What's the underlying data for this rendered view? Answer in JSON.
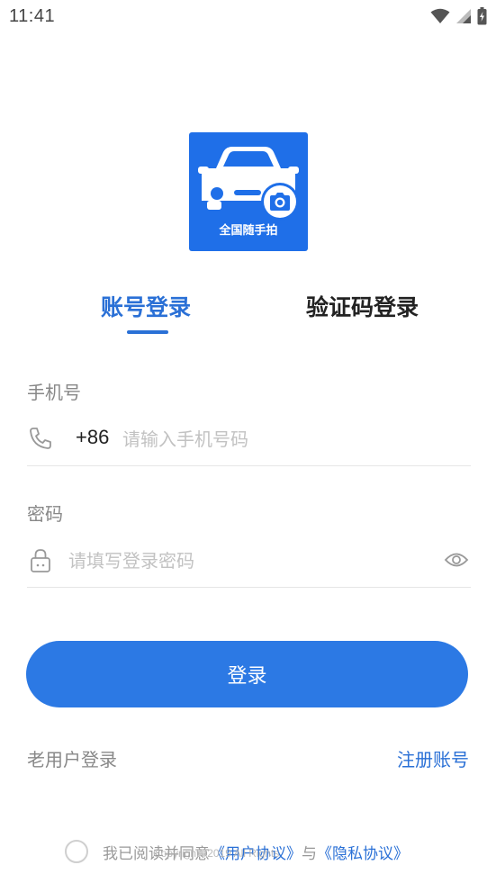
{
  "status_bar": {
    "time": "11:41"
  },
  "logo": {
    "text": "全国随手拍",
    "brand_color": "#1f6fe8"
  },
  "tabs": [
    {
      "label": "账号登录",
      "active": true
    },
    {
      "label": "验证码登录",
      "active": false
    }
  ],
  "phone_field": {
    "label": "手机号",
    "prefix": "+86",
    "placeholder": "请输入手机号码",
    "value": ""
  },
  "password_field": {
    "label": "密码",
    "placeholder": "请填写登录密码",
    "value": ""
  },
  "login_button": {
    "label": "登录"
  },
  "links": {
    "old_user": "老用户登录",
    "register": "注册账号"
  },
  "agreement": {
    "prefix": "我已阅读并同意",
    "user_agreement": "《用户协议》",
    "connector": "与",
    "privacy_policy": "《隐私协议》",
    "checked": false
  },
  "copyright": "Copyright©2019 All Rights",
  "colors": {
    "accent": "#2a70d6",
    "button": "#2c79e4"
  },
  "icons": [
    "wifi-icon",
    "signal-icon",
    "battery-icon",
    "car-icon",
    "camera-icon",
    "phone-icon",
    "lock-icon",
    "eye-icon"
  ]
}
